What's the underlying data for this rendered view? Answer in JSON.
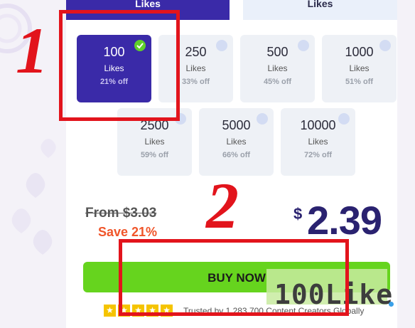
{
  "tabs": {
    "active_label": "Likes",
    "inactive_label": "Likes"
  },
  "packages": [
    {
      "qty": "100",
      "unit": "Likes",
      "off": "21% off",
      "selected": true
    },
    {
      "qty": "250",
      "unit": "Likes",
      "off": "33% off",
      "selected": false
    },
    {
      "qty": "500",
      "unit": "Likes",
      "off": "45% off",
      "selected": false
    },
    {
      "qty": "1000",
      "unit": "Likes",
      "off": "51% off",
      "selected": false
    },
    {
      "qty": "2500",
      "unit": "Likes",
      "off": "59% off",
      "selected": false
    },
    {
      "qty": "5000",
      "unit": "Likes",
      "off": "66% off",
      "selected": false
    },
    {
      "qty": "10000",
      "unit": "Likes",
      "off": "72% off",
      "selected": false
    }
  ],
  "pricing": {
    "old_price": "From $3.03",
    "save": "Save 21%",
    "currency": "$",
    "price": "2.39"
  },
  "buy_button": {
    "label": "BUY NOW"
  },
  "trust": {
    "rating_stars": 5,
    "text": "Trusted by 1,283,700 Content Creators Globally"
  },
  "annotations": {
    "one": "1",
    "two": "2"
  },
  "watermark": {
    "text": "100Like"
  },
  "colors": {
    "primary": "#3a2aa8",
    "cta": "#66d41e",
    "save": "#f0552a",
    "annotation": "#e2141c"
  }
}
